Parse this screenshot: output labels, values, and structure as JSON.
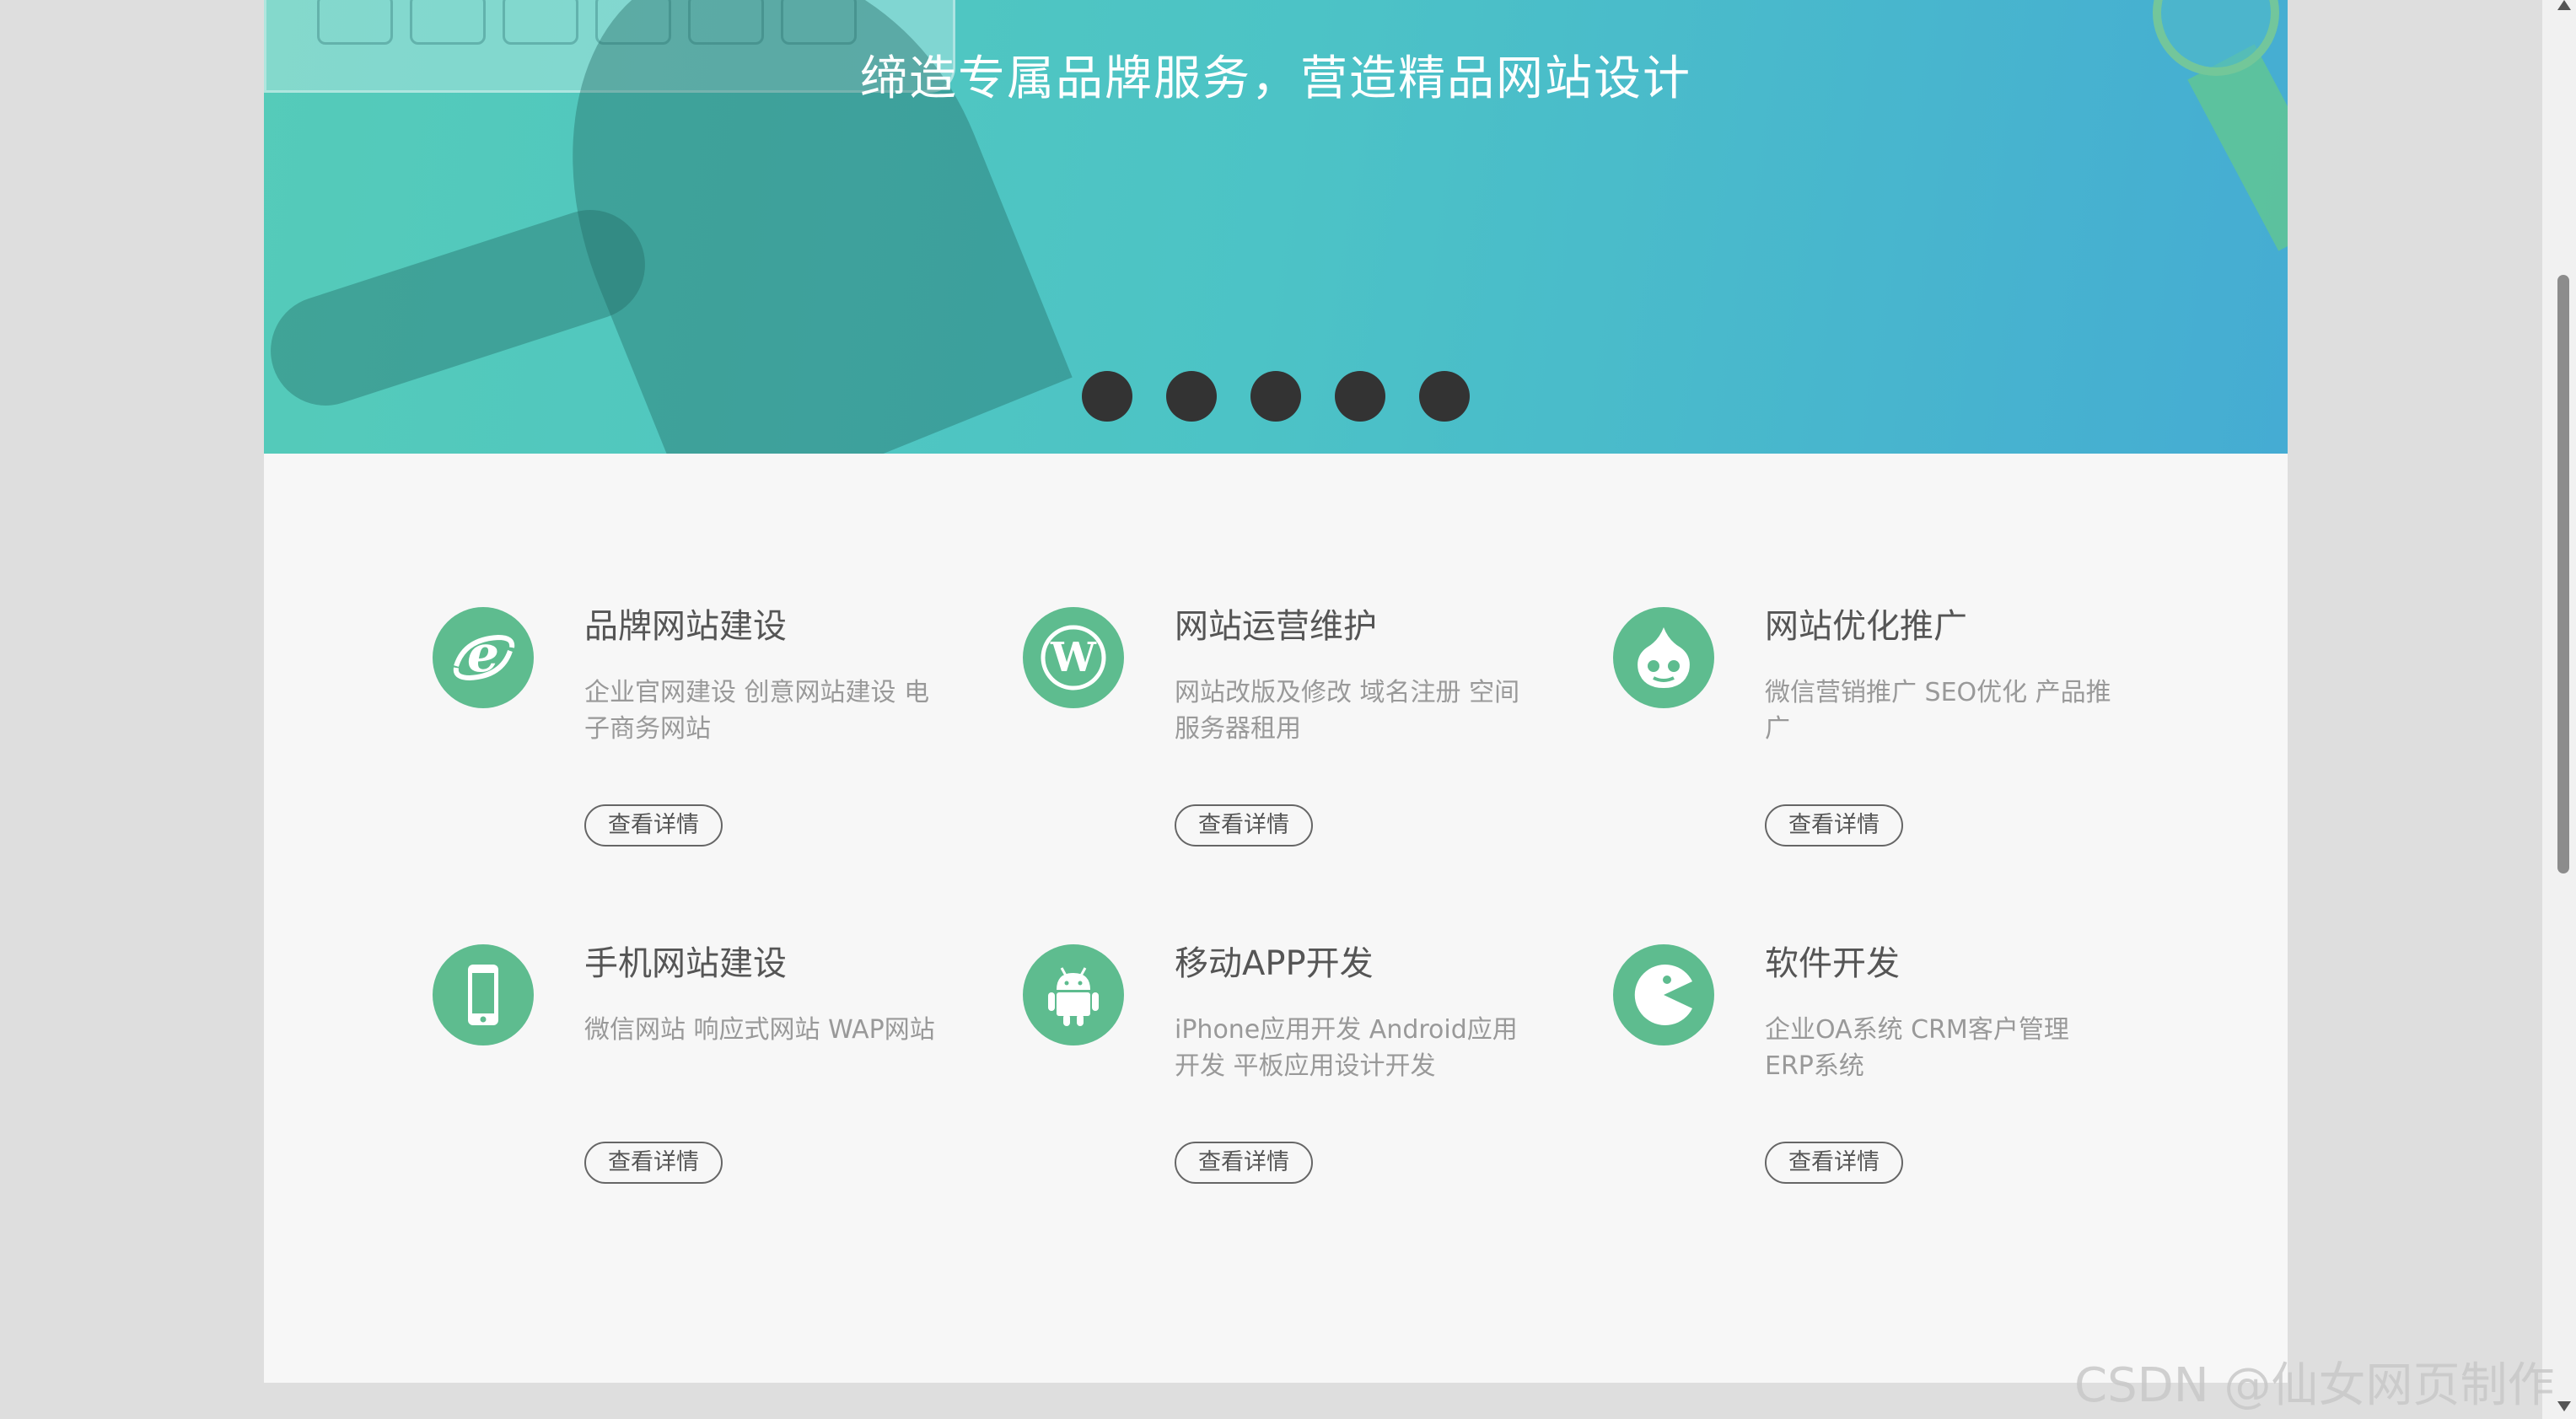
{
  "banner": {
    "title": "缔造专属品牌服务，营造精品网站设计",
    "dot_count": 5
  },
  "services": [
    {
      "title": "品牌网站建设",
      "desc": "企业官网建设 创意网站建设 电子商务网站",
      "button": "查看详情",
      "icon": "ie-icon"
    },
    {
      "title": "网站运营维护",
      "desc": "网站改版及修改 域名注册 空间服务器租用",
      "button": "查看详情",
      "icon": "wordpress-icon"
    },
    {
      "title": "网站优化推广",
      "desc": "微信营销推广 SEO优化 产品推广",
      "button": "查看详情",
      "icon": "drupal-icon"
    },
    {
      "title": "手机网站建设",
      "desc": "微信网站 响应式网站 WAP网站",
      "button": "查看详情",
      "icon": "mobile-icon"
    },
    {
      "title": "移动APP开发",
      "desc": "iPhone应用开发 Android应用开发 平板应用设计开发",
      "button": "查看详情",
      "icon": "android-icon"
    },
    {
      "title": "软件开发",
      "desc": "企业OA系统 CRM客户管理 ERP系统",
      "button": "查看详情",
      "icon": "pacman-icon"
    }
  ],
  "colors": {
    "accent": "#5ebc8f",
    "banner_start": "#55cbb9",
    "banner_end": "#45acd3",
    "dot": "#333333"
  },
  "watermark": "CSDN @仙女网页制作"
}
